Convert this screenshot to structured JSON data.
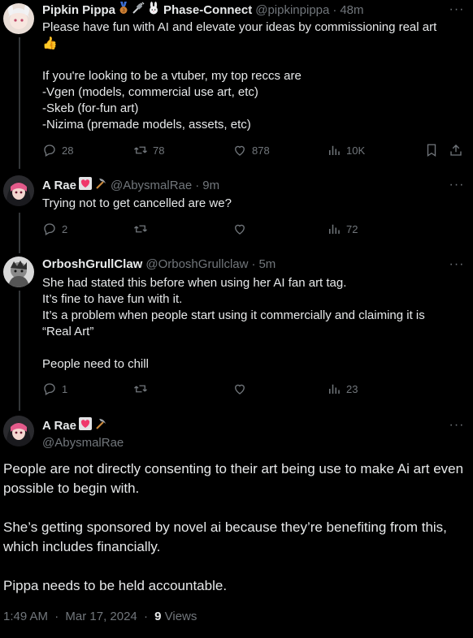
{
  "tweets": [
    {
      "name": "Pipkin Pippa",
      "name_badges": [
        "🥉",
        "🔌",
        "🐰"
      ],
      "name_suffix": "Phase-Connect",
      "handle": "@pipkinpippa",
      "time": "48m",
      "text": "Please have fun with AI and elevate your ideas by commissioning real art\n👍\n\nIf you're looking to be a vtuber, my top reccs are\n-Vgen (models, commercial use art, etc)\n-Skeb (for-fun art)\n-Nizima (premade models, assets, etc)",
      "replies": "28",
      "reposts": "78",
      "likes": "878",
      "views": "10K"
    },
    {
      "name": "A Rae",
      "handle": "@AbysmalRae",
      "time": "9m",
      "text": "Trying not to get cancelled are we?",
      "replies": "2",
      "reposts": "",
      "likes": "",
      "views": "72"
    },
    {
      "name": "OrboshGrullClaw",
      "handle": "@OrboshGrullclaw",
      "time": "5m",
      "text": "She had stated this before when using her AI fan art tag.\nIt’s fine to have fun with it.\nIt’s a problem when people start using it commercially and claiming it is\n“Real Art”\n\nPeople need to chill",
      "replies": "1",
      "reposts": "",
      "likes": "",
      "views": "23"
    }
  ],
  "main_tweet": {
    "name": "A Rae",
    "handle": "@AbysmalRae",
    "text": "People are not directly consenting to their art being use to make Ai art even possible to begin with.\n\nShe’s getting sponsored by novel ai because they’re benefiting from this, which includes financially.\n\nPippa needs to be held accountable.",
    "time": "1:49 AM",
    "date": "Mar 17, 2024",
    "views_count": "9",
    "views_label": "Views"
  },
  "separator": "·",
  "colors": {
    "background": "#000000",
    "text": "#e7e9ea",
    "muted": "#71767b",
    "thread_line": "#333639"
  },
  "icons": [
    "reply-icon",
    "repost-icon",
    "like-icon",
    "views-icon",
    "bookmark-icon",
    "share-icon",
    "more-icon",
    "heart-emoji",
    "pickaxe-emoji"
  ]
}
